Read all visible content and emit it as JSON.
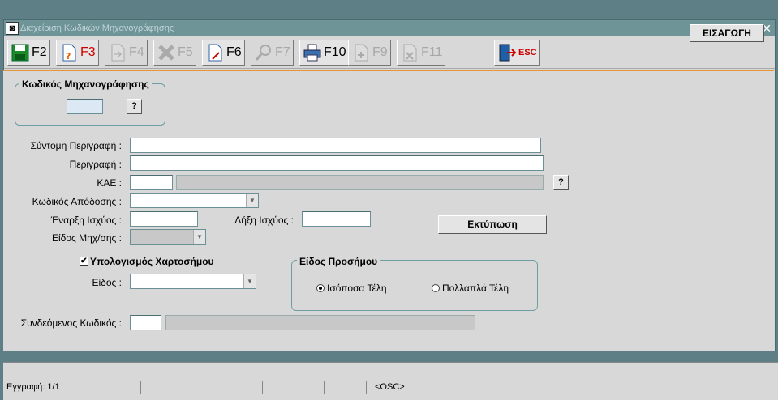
{
  "window": {
    "title": "Διαχείριση Κωδικών Μηχανογράφησης",
    "close_glyph": "✕"
  },
  "toolbar": {
    "buttons": [
      {
        "label": "F2",
        "icon": "save-icon",
        "enabled": true
      },
      {
        "label": "F3",
        "icon": "query-document-icon",
        "enabled": true
      },
      {
        "label": "F4",
        "icon": "document-arrow-icon",
        "enabled": false
      },
      {
        "label": "F5",
        "icon": "delete-x-icon",
        "enabled": false
      },
      {
        "label": "F6",
        "icon": "document-edit-icon",
        "enabled": true
      },
      {
        "label": "F7",
        "icon": "magnifier-icon",
        "enabled": false
      },
      {
        "label": "F10",
        "icon": "printer-icon",
        "enabled": true
      },
      {
        "label": "F9",
        "icon": "add-document-icon",
        "enabled": false
      },
      {
        "label": "F11",
        "icon": "remove-document-icon",
        "enabled": false
      },
      {
        "label": "ESC",
        "icon": "exit-door-icon",
        "enabled": true
      }
    ],
    "mode": "ΕΙΣΑΓΩΓΗ"
  },
  "form": {
    "code_group_title": "Κωδικός Μηχανογράφησης",
    "code_value": "",
    "help_glyph": "?",
    "short_desc_label": "Σύντομη Περιγραφή :",
    "short_desc_value": "",
    "desc_label": "Περιγραφή :",
    "desc_value": "",
    "kae_label": "ΚΑΕ :",
    "kae_code": "",
    "kae_desc": "",
    "remit_label": "Κωδικός Απόδοσης :",
    "remit_value": "",
    "start_label": "Έναρξη Ισχύος :",
    "start_value": "",
    "end_label": "Λήξη Ισχύος :",
    "end_value": "",
    "mech_type_label": "Είδος Μηχ/σης :",
    "mech_type_value": "",
    "print_button": "Εκτύπωση",
    "stamp_calc_label": "Υπολογισμός Χαρτοσήμου",
    "stamp_calc_checked": true,
    "check_glyph": "✔",
    "type_label": "Είδος :",
    "type_value": "",
    "surcharge_group_title": "Είδος Προσήμου",
    "radio_equal": "Ισόποσα Τέλη",
    "radio_multiple": "Πολλαπλά Τέλη",
    "linked_label": "Συνδεόμενος Κωδικός :",
    "linked_code": "",
    "linked_desc": ""
  },
  "status": {
    "record": "Εγγραφή: 1/1",
    "mode": "<OSC>"
  },
  "colors": {
    "titlebar": "#6f9498",
    "accent": "#e5963a",
    "background": "#5f7f86"
  }
}
